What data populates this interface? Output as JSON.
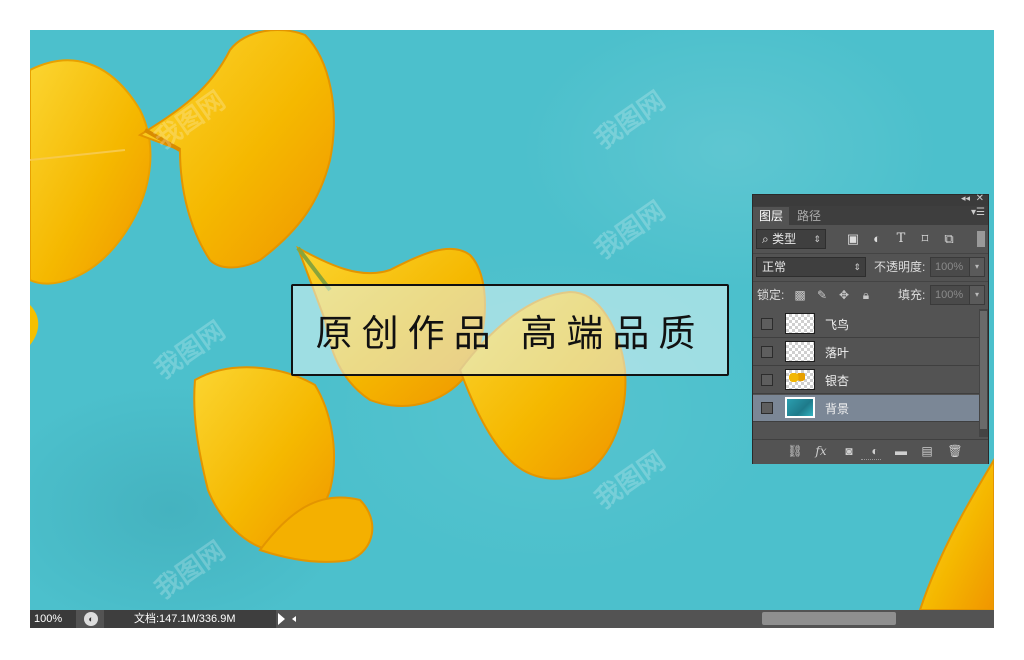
{
  "canvas": {
    "headline": "原创作品 高端品质",
    "watermark": "我图网",
    "background_color": "#4cc0cc",
    "leaf_color": "#f5b800"
  },
  "statusbar": {
    "zoom": "100%",
    "doc_info": "文档:147.1M/336.9M"
  },
  "layers_panel": {
    "tabs": [
      "图层",
      "路径"
    ],
    "filter_select": "类型",
    "filter_icons": [
      "image-filter-icon",
      "adjustment-filter-icon",
      "type-filter-icon",
      "shape-filter-icon",
      "smart-object-filter-icon"
    ],
    "blend_mode": "正常",
    "opacity_label": "不透明度:",
    "opacity_value": "100%",
    "lock_label": "锁定:",
    "fill_label": "填充:",
    "fill_value": "100%",
    "layers": [
      {
        "name": "飞鸟",
        "thumb": "transparent",
        "selected": false
      },
      {
        "name": "落叶",
        "thumb": "transparent",
        "selected": false
      },
      {
        "name": "银杏",
        "thumb": "ginkgo",
        "selected": false
      },
      {
        "name": "背景",
        "thumb": "background",
        "selected": true
      }
    ],
    "footer_icons": [
      "link-layers-icon",
      "fx-icon",
      "add-mask-icon",
      "adjustment-layer-icon",
      "new-group-icon",
      "new-layer-icon",
      "delete-layer-icon"
    ]
  }
}
